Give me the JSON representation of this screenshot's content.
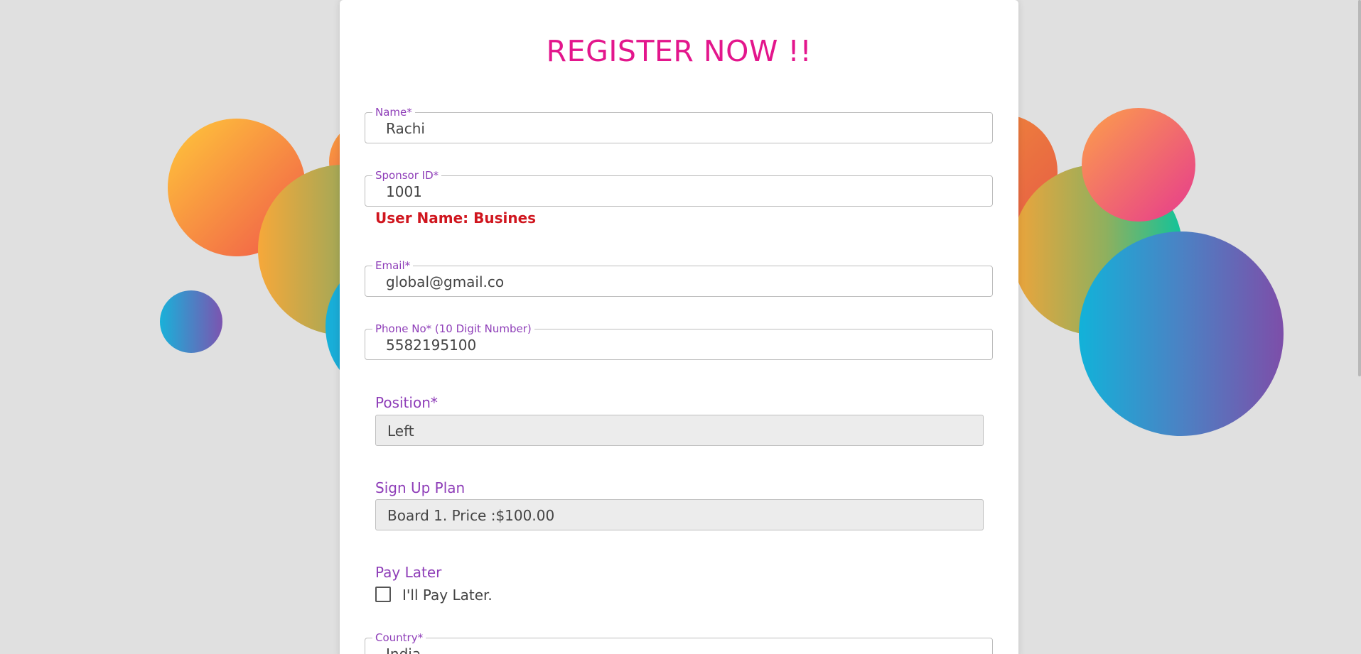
{
  "colors": {
    "title": "#e3168c",
    "label": "#8e3db8",
    "error": "#d0161f",
    "background": "#e0e0e0"
  },
  "form": {
    "title": "REGISTER NOW !!",
    "name": {
      "label": "Name*",
      "value": "Rachi"
    },
    "sponsor": {
      "label": "Sponsor ID*",
      "value": "1001"
    },
    "sponsor_hint": "User Name: Busines",
    "email": {
      "label": "Email*",
      "value": "global@gmail.co"
    },
    "phone": {
      "label": "Phone No* (10 Digit Number)",
      "value": "5582195100"
    },
    "position": {
      "label": "Position*",
      "value": "Left"
    },
    "plan": {
      "label": "Sign Up Plan",
      "value": "Board 1. Price :$100.00"
    },
    "pay_later": {
      "label": "Pay Later",
      "checkbox_label": "I'll Pay Later.",
      "checked": false
    },
    "country": {
      "label": "Country*",
      "value": "India"
    }
  }
}
